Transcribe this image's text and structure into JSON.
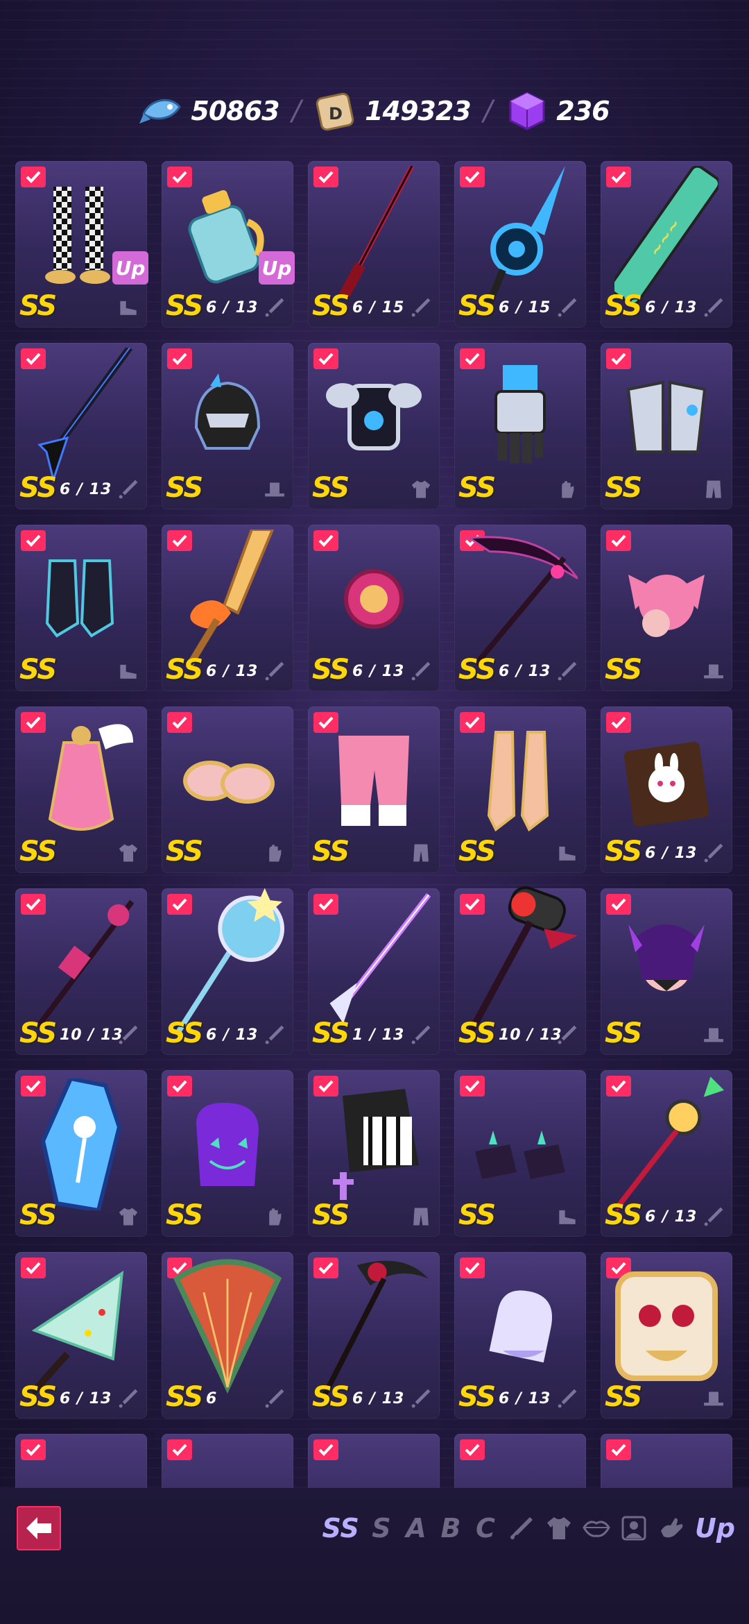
{
  "currencies": [
    {
      "name": "fish",
      "value": "50863"
    },
    {
      "name": "dice",
      "value": "149323"
    },
    {
      "name": "cube",
      "value": "236"
    }
  ],
  "separator": "/",
  "colors": {
    "rank": "#ffd60a",
    "check": "#ff2d64",
    "up": "#d46ad8",
    "active_filter": "#b8b0ff"
  },
  "items": [
    {
      "rank": "SS",
      "shards": "",
      "type": "shoes",
      "art": "checkered-stockings",
      "up": "Up"
    },
    {
      "rank": "SS",
      "shards": "6 / 13",
      "type": "weapon",
      "art": "water-jug",
      "up": "Up"
    },
    {
      "rank": "SS",
      "shards": "6 / 15",
      "type": "weapon",
      "art": "red-katana",
      "up": ""
    },
    {
      "rank": "SS",
      "shards": "6 / 15",
      "type": "weapon",
      "art": "cyber-blade",
      "up": ""
    },
    {
      "rank": "SS",
      "shards": "6 / 13",
      "type": "weapon",
      "art": "graffiti-board",
      "up": ""
    },
    {
      "rank": "SS",
      "shards": "6 / 13",
      "type": "weapon",
      "art": "dark-spear",
      "up": ""
    },
    {
      "rank": "SS",
      "shards": "",
      "type": "hat",
      "art": "mech-helmet",
      "up": ""
    },
    {
      "rank": "SS",
      "shards": "",
      "type": "shirt",
      "art": "mech-armor",
      "up": ""
    },
    {
      "rank": "SS",
      "shards": "",
      "type": "glove",
      "art": "mech-gauntlet",
      "up": ""
    },
    {
      "rank": "SS",
      "shards": "",
      "type": "pants",
      "art": "mech-legs",
      "up": ""
    },
    {
      "rank": "SS",
      "shards": "",
      "type": "shoes",
      "art": "dark-boots",
      "up": ""
    },
    {
      "rank": "SS",
      "shards": "6 / 13",
      "type": "weapon",
      "art": "flame-sword",
      "up": ""
    },
    {
      "rank": "SS",
      "shards": "6 / 13",
      "type": "weapon",
      "art": "yoyo",
      "up": ""
    },
    {
      "rank": "SS",
      "shards": "6 / 13",
      "type": "weapon",
      "art": "scythe",
      "up": ""
    },
    {
      "rank": "SS",
      "shards": "",
      "type": "hat",
      "art": "pink-hair",
      "up": ""
    },
    {
      "rank": "SS",
      "shards": "",
      "type": "shirt",
      "art": "angel-dress",
      "up": ""
    },
    {
      "rank": "SS",
      "shards": "",
      "type": "glove",
      "art": "gold-cuffs",
      "up": ""
    },
    {
      "rank": "SS",
      "shards": "",
      "type": "pants",
      "art": "pink-shorts",
      "up": ""
    },
    {
      "rank": "SS",
      "shards": "",
      "type": "shoes",
      "art": "gold-boots",
      "up": ""
    },
    {
      "rank": "SS",
      "shards": "6 / 13",
      "type": "weapon",
      "art": "bunny-bag",
      "up": ""
    },
    {
      "rank": "SS",
      "shards": "10 / 13",
      "type": "weapon",
      "art": "spiked-staff",
      "up": ""
    },
    {
      "rank": "SS",
      "shards": "6 / 13",
      "type": "weapon",
      "art": "snow-scepter",
      "up": ""
    },
    {
      "rank": "SS",
      "shards": "1 / 13",
      "type": "weapon",
      "art": "glow-spear",
      "up": ""
    },
    {
      "rank": "SS",
      "shards": "10 / 13",
      "type": "weapon",
      "art": "hammer",
      "up": ""
    },
    {
      "rank": "SS",
      "shards": "",
      "type": "hat",
      "art": "demon-mask",
      "up": ""
    },
    {
      "rank": "SS",
      "shards": "",
      "type": "shirt",
      "art": "coffin",
      "up": ""
    },
    {
      "rank": "SS",
      "shards": "",
      "type": "glove",
      "art": "pumpkin-mitt",
      "up": ""
    },
    {
      "rank": "SS",
      "shards": "",
      "type": "pants",
      "art": "goth-skirt",
      "up": ""
    },
    {
      "rank": "SS",
      "shards": "",
      "type": "shoes",
      "art": "spike-shoes",
      "up": ""
    },
    {
      "rank": "SS",
      "shards": "6 / 13",
      "type": "weapon",
      "art": "gear-spear",
      "up": ""
    },
    {
      "rank": "SS",
      "shards": "6 / 13",
      "type": "weapon",
      "art": "xmas-tree",
      "up": ""
    },
    {
      "rank": "SS",
      "shards": "6",
      "type": "weapon",
      "art": "fan",
      "up": ""
    },
    {
      "rank": "SS",
      "shards": "6 / 13",
      "type": "weapon",
      "art": "dark-scythe",
      "up": ""
    },
    {
      "rank": "SS",
      "shards": "6 / 13",
      "type": "weapon",
      "art": "ghost-glove",
      "up": ""
    },
    {
      "rank": "SS",
      "shards": "",
      "type": "hat",
      "art": "lion-mask",
      "up": ""
    },
    {
      "rank": "",
      "shards": "",
      "type": "",
      "art": "partial-a",
      "up": ""
    },
    {
      "rank": "",
      "shards": "",
      "type": "",
      "art": "partial-b",
      "up": ""
    },
    {
      "rank": "",
      "shards": "",
      "type": "",
      "art": "partial-c",
      "up": ""
    },
    {
      "rank": "",
      "shards": "",
      "type": "",
      "art": "partial-d",
      "up": ""
    },
    {
      "rank": "",
      "shards": "",
      "type": "",
      "art": "partial-e",
      "up": ""
    }
  ],
  "bottom": {
    "filters": [
      {
        "label": "SS",
        "active": true
      },
      {
        "label": "S",
        "active": false
      },
      {
        "label": "A",
        "active": false
      },
      {
        "label": "B",
        "active": false
      },
      {
        "label": "C",
        "active": false
      }
    ],
    "type_filters": [
      "weapon-icon",
      "shirt-icon",
      "lips-icon",
      "portrait-icon",
      "glove-icon"
    ],
    "up_label": "Up"
  }
}
